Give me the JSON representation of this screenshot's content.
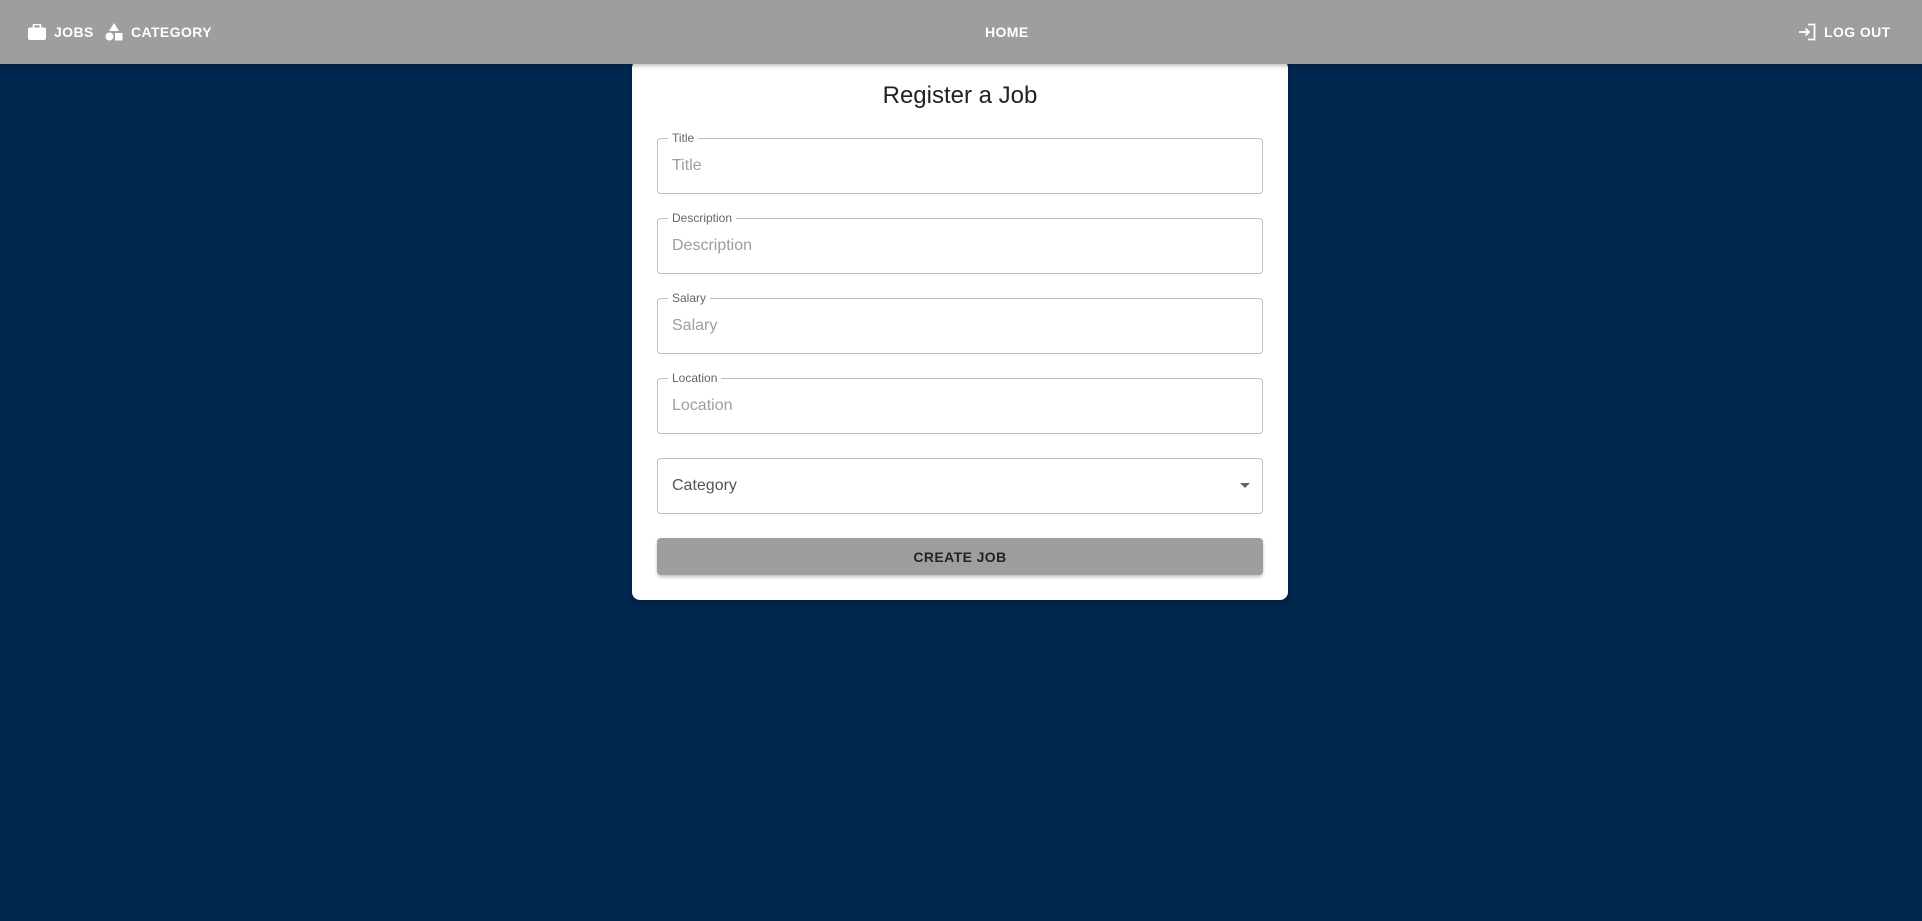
{
  "nav": {
    "jobs_label": "JOBS",
    "jobs_icon": "briefcase-icon",
    "category_label": "CATEGORY",
    "category_icon": "category-shapes-icon",
    "home_label": "HOME",
    "logout_label": "LOG OUT",
    "logout_icon": "login-arrow-icon"
  },
  "form": {
    "title": "Register a Job",
    "fields": [
      {
        "label": "Title",
        "placeholder": "Title",
        "value": ""
      },
      {
        "label": "Description",
        "placeholder": "Description",
        "value": ""
      },
      {
        "label": "Salary",
        "placeholder": "Salary",
        "value": ""
      },
      {
        "label": "Location",
        "placeholder": "Location",
        "value": ""
      }
    ],
    "category_select": {
      "placeholder": "Category",
      "selected": ""
    },
    "submit_label": "CREATE JOB"
  },
  "colors": {
    "background": "#00274f",
    "navbar": "#9e9e9e",
    "card": "#ffffff",
    "button": "#9e9e9e"
  }
}
